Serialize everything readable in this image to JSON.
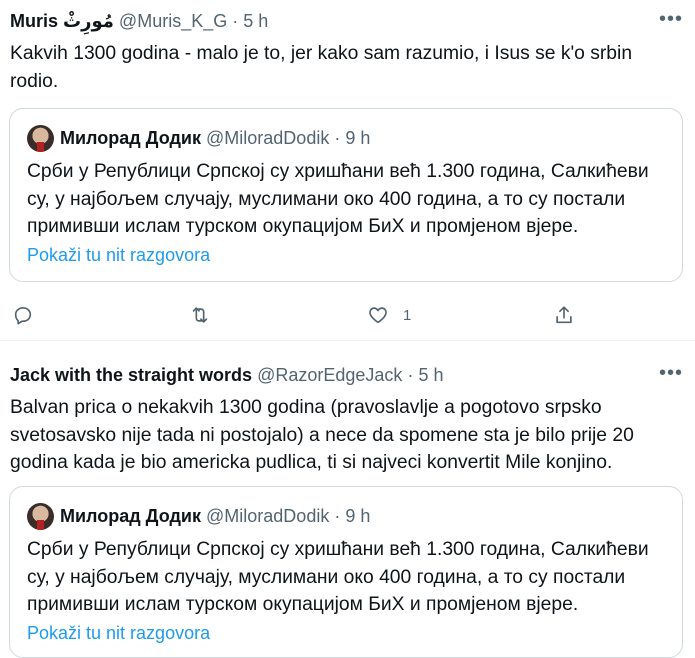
{
  "tweets": [
    {
      "author_name": "Muris مُورِثْ",
      "author_handle": "@Muris_K_G",
      "dot": "·",
      "time": "5 h",
      "more": "•••",
      "text": "Kakvih 1300 godina - malo je to, jer kako sam razumio,  i Isus se k'o srbin rodio.",
      "quote": {
        "author_name": "Милорад Додик",
        "author_handle": "@MiloradDodik",
        "dot": "·",
        "time": "9 h",
        "text": "Срби у Републици Српској су хришћани већ 1.300 година, Салкићеви су, у најбољем случају, муслимани око 400 година, а то су постали примивши ислам турском окупацијом БиХ и промјеном вјере.",
        "show_thread": "Pokaži tu nit razgovora"
      },
      "actions": {
        "reply_icon": "reply-icon",
        "retweet_icon": "retweet-icon",
        "like_icon": "heart-icon",
        "like_count": "1",
        "share_icon": "share-icon"
      }
    },
    {
      "author_name": "Jack with the straight words",
      "author_handle": "@RazorEdgeJack",
      "dot": "·",
      "time": "5 h",
      "more": "•••",
      "text": "Balvan prica o nekakvih 1300 godina (pravoslavlje a pogotovo srpsko svetosavsko nije tada ni postojalo) a nece da spomene sta je bilo prije 20 godina kada je bio americka pudlica, ti si najveci konvertit Mile konjino.",
      "quote": {
        "author_name": "Милорад Додик",
        "author_handle": "@MiloradDodik",
        "dot": "·",
        "time": "9 h",
        "text": "Срби у Републици Српској су хришћани већ 1.300 година, Салкићеви су, у најбољем случају, муслимани око 400 година, а то су постали примивши ислам турском окупацијом БиХ и промјеном вјере.",
        "show_thread": "Pokaži tu nit razgovora"
      }
    }
  ],
  "colors": {
    "text": "#0f1419",
    "secondary": "#536471",
    "link": "#1d9bf0",
    "border": "#cfd9de"
  }
}
